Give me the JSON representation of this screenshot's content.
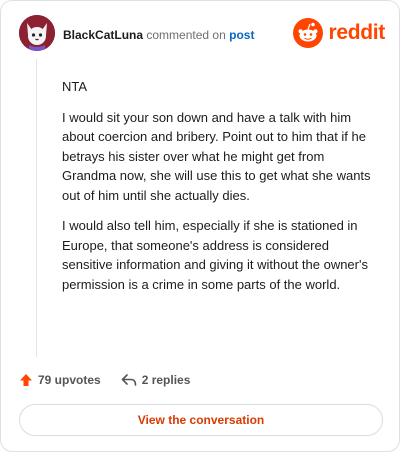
{
  "header": {
    "username": "BlackCatLuna",
    "action_text": "commented on",
    "post_link": "post",
    "brand": "reddit"
  },
  "comment": {
    "paragraphs": [
      "NTA",
      "I would sit your son down and have a talk with him about coercion and bribery. Point out to him that if he betrays his sister over what he might get from Grandma now, she will use this to get what she wants out of him until she actually dies.",
      "I would also tell him, especially if she is stationed in Europe, that someone's address is considered sensitive information and giving it without the owner's permission is a crime in some parts of the world."
    ]
  },
  "actions": {
    "upvotes": "79 upvotes",
    "replies": "2 replies"
  },
  "cta": {
    "label": "View the conversation"
  },
  "colors": {
    "brand": "#ff4500",
    "link": "#0a66c2",
    "cta_text": "#d93a00"
  },
  "icons": {
    "avatar": "black-cat-avatar",
    "logo": "reddit-snoo-icon",
    "upvote": "upvote-arrow-icon",
    "reply": "reply-arrow-icon"
  }
}
